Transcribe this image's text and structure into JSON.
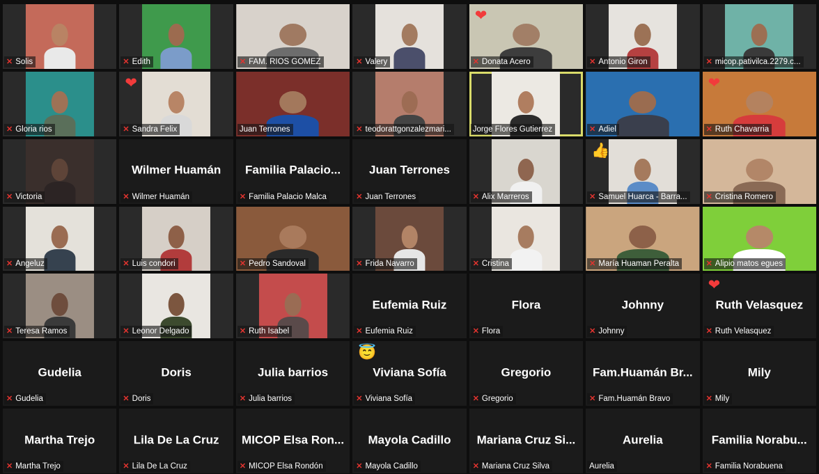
{
  "meeting": {
    "view": "gallery",
    "active_speaker": "Jorge Flores Gutierrez",
    "colors": {
      "active_border": "#d9db6a",
      "muted_icon": "#e3342f",
      "reaction_heart": "#f23b3b"
    }
  },
  "participants": [
    {
      "name": "Solis",
      "display_name": "",
      "video": true,
      "muted": true,
      "reaction": "",
      "bg": "#c46a5a",
      "skin": "#b98364",
      "shirt": "#e9e9e9"
    },
    {
      "name": "Edith",
      "display_name": "",
      "video": true,
      "muted": true,
      "reaction": "",
      "bg": "#3f9a4c",
      "skin": "#9c6b4f",
      "shirt": "#7b9cc9"
    },
    {
      "name": "FAM. RIOS GOMEZ",
      "display_name": "",
      "video": true,
      "muted": true,
      "reaction": "",
      "bg": "#d8d2cb",
      "skin": "#a07a62",
      "shirt": "#6d6d6d"
    },
    {
      "name": "Valery",
      "display_name": "",
      "video": true,
      "muted": true,
      "reaction": "",
      "bg": "#e5e1dc",
      "skin": "#a37b60",
      "shirt": "#4b4f6b"
    },
    {
      "name": "Donata Acero",
      "display_name": "",
      "video": true,
      "muted": true,
      "reaction": "heart",
      "bg": "#c9c6b3",
      "skin": "#a27f67",
      "shirt": "#3d3d3d"
    },
    {
      "name": "Antonio Giron",
      "display_name": "",
      "video": true,
      "muted": true,
      "reaction": "",
      "bg": "#e6e3de",
      "skin": "#9c7256",
      "shirt": "#b54141"
    },
    {
      "name": "micop.pativilca.2279.c...",
      "display_name": "",
      "video": true,
      "muted": true,
      "reaction": "",
      "bg": "#6fb2a7",
      "skin": "#9c6f53",
      "shirt": "#3a3a3a"
    },
    {
      "name": "Gloria rios",
      "display_name": "",
      "video": true,
      "muted": true,
      "reaction": "",
      "bg": "#2b8f8b",
      "skin": "#9e7256",
      "shirt": "#5a6f5a"
    },
    {
      "name": "Sandra Felix",
      "display_name": "",
      "video": true,
      "muted": true,
      "reaction": "heart",
      "bg": "#e3ddd4",
      "skin": "#b88566",
      "shirt": "#d9d9d9"
    },
    {
      "name": "Juan Terrones",
      "display_name": "",
      "video": true,
      "muted": false,
      "reaction": "",
      "bg": "#7b2f2a",
      "skin": "#a3785c",
      "shirt": "#1d4fa5"
    },
    {
      "name": "teodorattgonzalezmari...",
      "display_name": "",
      "video": true,
      "muted": true,
      "reaction": "",
      "bg": "#b57d6c",
      "skin": "#9d6c54",
      "shirt": "#444444"
    },
    {
      "name": "Jorge Flores Gutierrez",
      "display_name": "",
      "video": true,
      "muted": false,
      "reaction": "",
      "bg": "#ece9e3",
      "skin": "#b07e60",
      "shirt": "#2b2b2b",
      "active": true
    },
    {
      "name": "Adiel",
      "display_name": "",
      "video": true,
      "muted": true,
      "reaction": "",
      "bg": "#2a6fb0",
      "skin": "#9a6c50",
      "shirt": "#3a3f4d"
    },
    {
      "name": "Ruth Chavarria",
      "display_name": "",
      "video": true,
      "muted": true,
      "reaction": "heart",
      "bg": "#c77a3a",
      "skin": "#b4825f",
      "shirt": "#d63c3c"
    },
    {
      "name": "Victoria",
      "display_name": "",
      "video": true,
      "muted": true,
      "reaction": "",
      "bg": "#3a2f2c",
      "skin": "#5e4438",
      "shirt": "#2c2424"
    },
    {
      "name": "Wilmer Huamán",
      "display_name": "Wilmer Huamán",
      "video": false,
      "muted": true,
      "reaction": ""
    },
    {
      "name": "Familia Palacio Malca",
      "display_name": "Familia  Palacio...",
      "video": false,
      "muted": true,
      "reaction": ""
    },
    {
      "name": "Juan Terrones",
      "display_name": "Juan Terrones",
      "video": false,
      "muted": true,
      "reaction": ""
    },
    {
      "name": "Alix Marreros",
      "display_name": "",
      "video": true,
      "muted": true,
      "reaction": "",
      "bg": "#d9d6cf",
      "skin": "#8f6650",
      "shirt": "#f0f0f0"
    },
    {
      "name": "Samuel Huarca - Barra...",
      "display_name": "",
      "video": true,
      "muted": true,
      "reaction": "thumbs",
      "bg": "#e2ded8",
      "skin": "#a57a5d",
      "shirt": "#5b8cc7"
    },
    {
      "name": "Cristina Romero",
      "display_name": "",
      "video": true,
      "muted": true,
      "reaction": "",
      "bg": "#d4b79a",
      "skin": "#b28668",
      "shirt": "#8a6a55"
    },
    {
      "name": "Angeluz",
      "display_name": "",
      "video": true,
      "muted": true,
      "reaction": "",
      "bg": "#e4e1da",
      "skin": "#9a6c52",
      "shirt": "#36424f"
    },
    {
      "name": "Luis condori",
      "display_name": "",
      "video": true,
      "muted": true,
      "reaction": "",
      "bg": "#d6cfc7",
      "skin": "#8e6048",
      "shirt": "#b23c3c"
    },
    {
      "name": "Pedro Sandoval",
      "display_name": "",
      "video": true,
      "muted": true,
      "reaction": "",
      "bg": "#8a5a3c",
      "skin": "#a97a5c",
      "shirt": "#2a2a2a"
    },
    {
      "name": "Frida Navarro",
      "display_name": "",
      "video": true,
      "muted": true,
      "reaction": "",
      "bg": "#6b4a3c",
      "skin": "#b28466",
      "shirt": "#e6e6e6"
    },
    {
      "name": "Cristina",
      "display_name": "",
      "video": true,
      "muted": true,
      "reaction": "",
      "bg": "#eae6e0",
      "skin": "#a77c60",
      "shirt": "#f2f2f2"
    },
    {
      "name": "María Huaman Peralta",
      "display_name": "",
      "video": true,
      "muted": true,
      "reaction": "",
      "bg": "#caa57e",
      "skin": "#8d6149",
      "shirt": "#3e5e3a"
    },
    {
      "name": "Alipio matos egues",
      "display_name": "",
      "video": true,
      "muted": true,
      "reaction": "",
      "bg": "#7fcf3a",
      "skin": "#b58968",
      "shirt": "#ffffff"
    },
    {
      "name": "Teresa Ramos",
      "display_name": "",
      "video": true,
      "muted": true,
      "reaction": "",
      "bg": "#9b8e83",
      "skin": "#6e4d3d",
      "shirt": "#3a3a3a"
    },
    {
      "name": "Leonor Delgado",
      "display_name": "",
      "video": true,
      "muted": true,
      "reaction": "",
      "bg": "#e9e6e1",
      "skin": "#7c563f",
      "shirt": "#3c4a2e"
    },
    {
      "name": "Ruth Isabel",
      "display_name": "",
      "video": true,
      "muted": true,
      "reaction": "",
      "bg": "#c44c4c",
      "skin": "#9a6c54",
      "shirt": "#5a4a4a"
    },
    {
      "name": "Eufemia Ruiz",
      "display_name": "Eufemia Ruiz",
      "video": false,
      "muted": true,
      "reaction": ""
    },
    {
      "name": "Flora",
      "display_name": "Flora",
      "video": false,
      "muted": true,
      "reaction": ""
    },
    {
      "name": "Johnny",
      "display_name": "Johnny",
      "video": false,
      "muted": true,
      "reaction": ""
    },
    {
      "name": "Ruth Velasquez",
      "display_name": "Ruth Velasquez",
      "video": false,
      "muted": true,
      "reaction": "heart"
    },
    {
      "name": "Gudelia",
      "display_name": "Gudelia",
      "video": false,
      "muted": true,
      "reaction": ""
    },
    {
      "name": "Doris",
      "display_name": "Doris",
      "video": false,
      "muted": true,
      "reaction": ""
    },
    {
      "name": "Julia barrios",
      "display_name": "Julia barrios",
      "video": false,
      "muted": true,
      "reaction": ""
    },
    {
      "name": "Viviana Sofía",
      "display_name": "Viviana Sofía",
      "video": false,
      "muted": true,
      "reaction": "halo"
    },
    {
      "name": "Gregorio",
      "display_name": "Gregorio",
      "video": false,
      "muted": true,
      "reaction": ""
    },
    {
      "name": "Fam.Huamán Bravo",
      "display_name": "Fam.Huamán  Br...",
      "video": false,
      "muted": true,
      "reaction": ""
    },
    {
      "name": "Mily",
      "display_name": "Mily",
      "video": false,
      "muted": true,
      "reaction": ""
    },
    {
      "name": "Martha Trejo",
      "display_name": "Martha Trejo",
      "video": false,
      "muted": true,
      "reaction": ""
    },
    {
      "name": "Lila De La Cruz",
      "display_name": "Lila De La Cruz",
      "video": false,
      "muted": true,
      "reaction": ""
    },
    {
      "name": "MICOP Elsa Rondón",
      "display_name": "MICOP  Elsa Ron...",
      "video": false,
      "muted": true,
      "reaction": ""
    },
    {
      "name": "Mayola Cadillo",
      "display_name": "Mayola Cadillo",
      "video": false,
      "muted": true,
      "reaction": ""
    },
    {
      "name": "Mariana Cruz Silva",
      "display_name": "Mariana Cruz Si...",
      "video": false,
      "muted": true,
      "reaction": ""
    },
    {
      "name": "Aurelia",
      "display_name": "Aurelia",
      "video": false,
      "muted": false,
      "reaction": ""
    },
    {
      "name": "Familia Norabuena",
      "display_name": "Familia  Norabu...",
      "video": false,
      "muted": true,
      "reaction": ""
    }
  ]
}
